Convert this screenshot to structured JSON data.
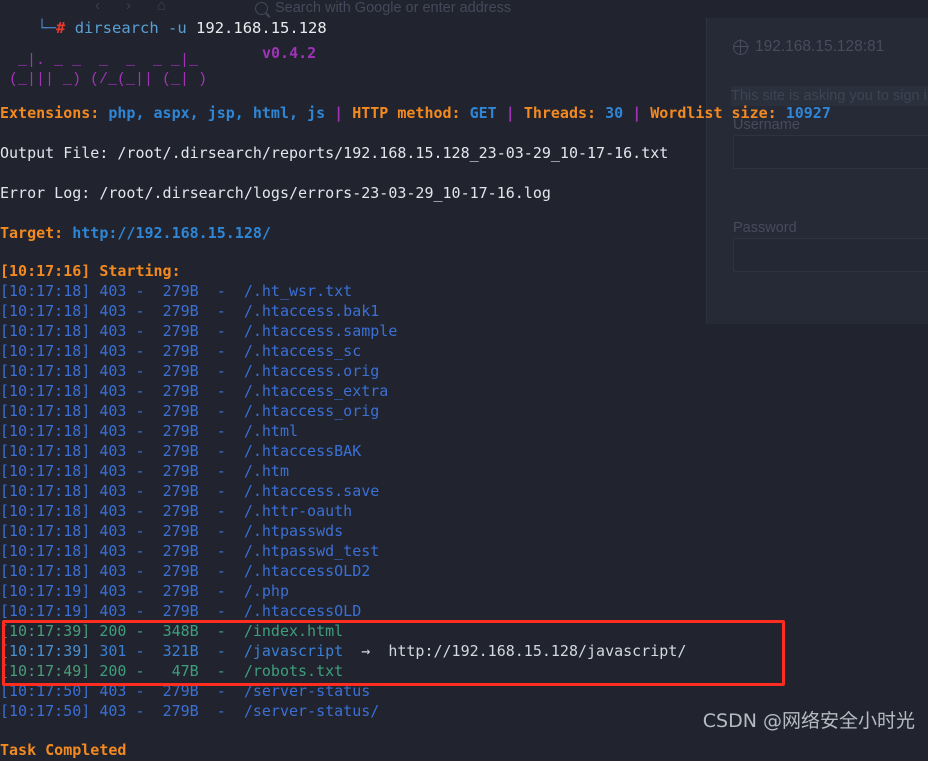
{
  "browser_ghost": {
    "nav_icons": [
      "back-arrow",
      "forward-arrow",
      "home"
    ],
    "urlbar_placeholder": "Search with Google or enter address",
    "dialog": {
      "site": "192.168.15.128:81",
      "message": "This site is asking you to sign in",
      "username_label": "Username",
      "password_label": "Password",
      "username_value": "",
      "password_value": ""
    }
  },
  "terminal": {
    "prompt": {
      "corner": "└─",
      "symbol": "#",
      "command": "dirsearch",
      "flag": "-u",
      "argument": "192.168.15.128"
    },
    "banner_art": "  _|. _ _  _  _  _ _|_    \n (_||| _) (/_(_|| (_| )   ",
    "version": "v0.4.2",
    "meta": {
      "extensions_label": "Extensions:",
      "extensions_value": "php, aspx, jsp, html, js",
      "method_label": "HTTP method:",
      "method_value": "GET",
      "threads_label": "Threads:",
      "threads_value": "30",
      "wordlist_label": "Wordlist size:",
      "wordlist_value": "10927",
      "separator": "|"
    },
    "output_file_label": "Output File:",
    "output_file_value": "/root/.dirsearch/reports/192.168.15.128_23-03-29_10-17-16.txt",
    "error_log_label": "Error Log:",
    "error_log_value": "/root/.dirsearch/logs/errors-23-03-29_10-17-16.log",
    "target_label": "Target:",
    "target_value": "http://192.168.15.128/",
    "starting_time": "[10:17:16]",
    "starting_label": "Starting:",
    "task_completed": "Task Completed",
    "results": [
      {
        "time": "[10:17:18]",
        "status": "403",
        "size": "279B",
        "path": "/.ht_wsr.txt",
        "redirect": ""
      },
      {
        "time": "[10:17:18]",
        "status": "403",
        "size": "279B",
        "path": "/.htaccess.bak1",
        "redirect": ""
      },
      {
        "time": "[10:17:18]",
        "status": "403",
        "size": "279B",
        "path": "/.htaccess.sample",
        "redirect": ""
      },
      {
        "time": "[10:17:18]",
        "status": "403",
        "size": "279B",
        "path": "/.htaccess_sc",
        "redirect": ""
      },
      {
        "time": "[10:17:18]",
        "status": "403",
        "size": "279B",
        "path": "/.htaccess.orig",
        "redirect": ""
      },
      {
        "time": "[10:17:18]",
        "status": "403",
        "size": "279B",
        "path": "/.htaccess_extra",
        "redirect": ""
      },
      {
        "time": "[10:17:18]",
        "status": "403",
        "size": "279B",
        "path": "/.htaccess_orig",
        "redirect": ""
      },
      {
        "time": "[10:17:18]",
        "status": "403",
        "size": "279B",
        "path": "/.html",
        "redirect": ""
      },
      {
        "time": "[10:17:18]",
        "status": "403",
        "size": "279B",
        "path": "/.htaccessBAK",
        "redirect": ""
      },
      {
        "time": "[10:17:18]",
        "status": "403",
        "size": "279B",
        "path": "/.htm",
        "redirect": ""
      },
      {
        "time": "[10:17:18]",
        "status": "403",
        "size": "279B",
        "path": "/.htaccess.save",
        "redirect": ""
      },
      {
        "time": "[10:17:18]",
        "status": "403",
        "size": "279B",
        "path": "/.httr-oauth",
        "redirect": ""
      },
      {
        "time": "[10:17:18]",
        "status": "403",
        "size": "279B",
        "path": "/.htpasswds",
        "redirect": ""
      },
      {
        "time": "[10:17:18]",
        "status": "403",
        "size": "279B",
        "path": "/.htpasswd_test",
        "redirect": ""
      },
      {
        "time": "[10:17:18]",
        "status": "403",
        "size": "279B",
        "path": "/.htaccessOLD2",
        "redirect": ""
      },
      {
        "time": "[10:17:19]",
        "status": "403",
        "size": "279B",
        "path": "/.php",
        "redirect": ""
      },
      {
        "time": "[10:17:19]",
        "status": "403",
        "size": "279B",
        "path": "/.htaccessOLD",
        "redirect": ""
      },
      {
        "time": "[10:17:39]",
        "status": "200",
        "size": "348B",
        "path": "/index.html",
        "redirect": ""
      },
      {
        "time": "[10:17:39]",
        "status": "301",
        "size": "321B",
        "path": "/javascript",
        "redirect": "http://192.168.15.128/javascript/"
      },
      {
        "time": "[10:17:49]",
        "status": "200",
        "size": " 47B",
        "path": "/robots.txt",
        "redirect": ""
      },
      {
        "time": "[10:17:50]",
        "status": "403",
        "size": "279B",
        "path": "/server-status",
        "redirect": ""
      },
      {
        "time": "[10:17:50]",
        "status": "403",
        "size": "279B",
        "path": "/server-status/",
        "redirect": ""
      }
    ],
    "redirect_arrow": "→"
  },
  "annotation": {
    "highlight_color": "#ff2d20"
  },
  "watermark": "CSDN @网络安全小时光"
}
